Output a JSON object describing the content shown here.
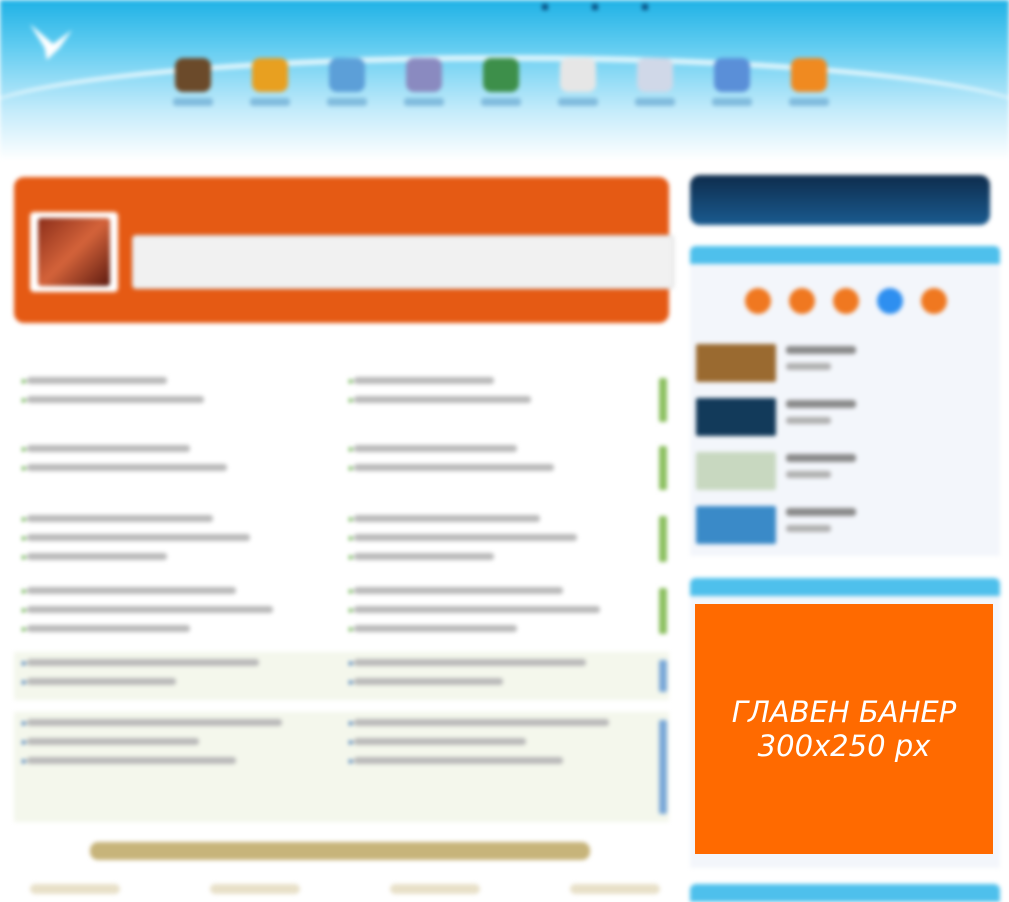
{
  "main_banner": {
    "line1": "ГЛАВЕН БАНЕР",
    "line2": "300x250 px"
  },
  "colors": {
    "accent_orange": "#ff6a00",
    "header_blue": "#1fb2e6",
    "info_orange": "#e55a14"
  },
  "icons": [
    {
      "name": "home-icon",
      "color": "#6b4a2a"
    },
    {
      "name": "umbrella-icon",
      "color": "#e8a020"
    },
    {
      "name": "plane-icon",
      "color": "#5c9fd8"
    },
    {
      "name": "hotel-icon",
      "color": "#8a8ac0"
    },
    {
      "name": "globe-icon",
      "color": "#3d8f4a"
    },
    {
      "name": "document-icon",
      "color": "#e6e6e6"
    },
    {
      "name": "disc-icon",
      "color": "#d0d8e8"
    },
    {
      "name": "calendar-icon",
      "color": "#5a8fd8"
    },
    {
      "name": "ball-icon",
      "color": "#f08a20"
    }
  ],
  "news_rows": [
    {
      "left_count": 2,
      "right_count": 2,
      "bar": "#8cc060"
    },
    {
      "left_count": 2,
      "right_count": 2,
      "bar": "#8cc060"
    },
    {
      "left_count": 3,
      "right_count": 3,
      "bar": "#8cc060"
    },
    {
      "left_count": 3,
      "right_count": 3,
      "bar": "#8cc060"
    },
    {
      "left_count": 2,
      "right_count": 2,
      "bar": "#7aa8d8"
    },
    {
      "left_count": 3,
      "right_count": 3,
      "bar": "#7aa8d8"
    }
  ],
  "promo_rows": [
    {
      "img": "#9a6a30"
    },
    {
      "img": "#123a5a"
    },
    {
      "img": "#c8d8c0"
    },
    {
      "img": "#3a8ac8"
    }
  ]
}
